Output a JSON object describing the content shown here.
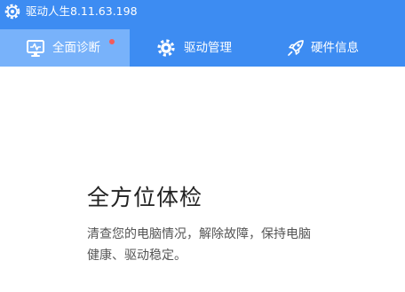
{
  "app": {
    "title": "驱动人生8.11.63.198",
    "logo_icon": "gear-logo-icon"
  },
  "colors": {
    "header_bg": "#3d8cf2",
    "active_tab_bg": "#78b2fa",
    "notification_dot": "#f35b5b",
    "title_text": "#222222",
    "body_text": "#555555"
  },
  "tabs": [
    {
      "label": "全面诊断",
      "icon": "monitor-pulse-icon",
      "active": true,
      "has_notification": true
    },
    {
      "label": "驱动管理",
      "icon": "gear-icon",
      "active": false
    },
    {
      "label": "硬件信息",
      "icon": "rocket-icon",
      "active": false
    }
  ],
  "main": {
    "title": "全方位体检",
    "description_line1": "清查您的电脑情况，解除故障，保持电脑",
    "description_line2": "健康、驱动稳定。"
  }
}
